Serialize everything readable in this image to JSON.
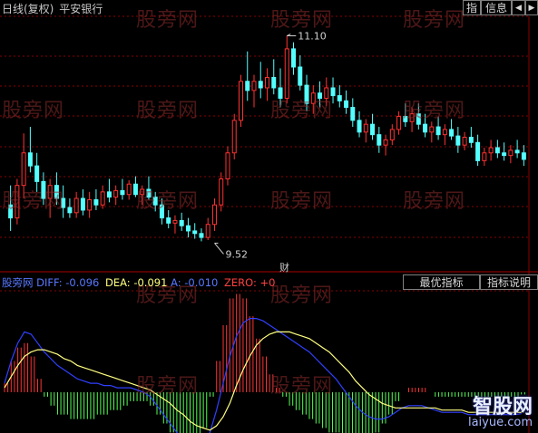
{
  "header": {
    "title": "日线(复权)",
    "stock_name": "平安银行",
    "btn_index": "指",
    "btn_info": "信息",
    "arrow_left": "◀",
    "arrow_right": "▶"
  },
  "indicator_header": {
    "name": "股旁网",
    "diff_label": "DIFF:",
    "diff_value": "-0.096",
    "dea_label": "DEA:",
    "dea_value": "-0.091",
    "a_label": "A:",
    "a_value": "-0.010",
    "zero_label": "ZERO:",
    "zero_value": "+0",
    "btn_best": "最优指标",
    "btn_help": "指标说明"
  },
  "watermark": "股旁网",
  "finance_marker": "财",
  "brand": {
    "cn": "智股网",
    "url": "laiyue.com"
  },
  "colors": {
    "background": "#000000",
    "up": "#ff3232",
    "down": "#54ffff",
    "grid": "#8b0000",
    "diff": "#3040ff",
    "dea": "#ffff80",
    "hist_up": "#ff3232",
    "hist_down": "#54ff54",
    "text_blue": "#5878ff",
    "text_yellow": "#ffff80",
    "text_red": "#ff4040"
  },
  "chart_data": [
    {
      "type": "candlestick",
      "ylim": [
        9.3,
        11.25
      ],
      "annotations": [
        {
          "label": "11.10",
          "index": 42,
          "value": 11.1
        },
        {
          "label": "9.52",
          "index": 31,
          "value": 9.52
        }
      ],
      "ohlc": [
        [
          9.8,
          9.95,
          9.6,
          9.7
        ],
        [
          9.7,
          10.0,
          9.65,
          9.95
        ],
        [
          9.95,
          10.35,
          9.85,
          10.2
        ],
        [
          10.2,
          10.4,
          10.05,
          10.1
        ],
        [
          10.1,
          10.2,
          9.9,
          9.98
        ],
        [
          9.98,
          10.05,
          9.8,
          9.85
        ],
        [
          9.85,
          10.0,
          9.7,
          9.95
        ],
        [
          9.95,
          10.05,
          9.8,
          9.85
        ],
        [
          9.85,
          9.95,
          9.7,
          9.78
        ],
        [
          9.78,
          9.85,
          9.7,
          9.74
        ],
        [
          9.74,
          9.9,
          9.7,
          9.85
        ],
        [
          9.85,
          9.92,
          9.72,
          9.76
        ],
        [
          9.76,
          9.9,
          9.7,
          9.84
        ],
        [
          9.84,
          9.92,
          9.76,
          9.8
        ],
        [
          9.8,
          9.95,
          9.77,
          9.9
        ],
        [
          9.9,
          10.0,
          9.82,
          9.86
        ],
        [
          9.86,
          9.95,
          9.8,
          9.91
        ],
        [
          9.91,
          10.0,
          9.84,
          9.88
        ],
        [
          9.88,
          9.99,
          9.84,
          9.96
        ],
        [
          9.96,
          10.02,
          9.86,
          9.88
        ],
        [
          9.88,
          9.95,
          9.8,
          9.92
        ],
        [
          9.92,
          10.02,
          9.84,
          9.86
        ],
        [
          9.86,
          9.9,
          9.75,
          9.8
        ],
        [
          9.8,
          9.85,
          9.65,
          9.7
        ],
        [
          9.7,
          9.76,
          9.62,
          9.66
        ],
        [
          9.66,
          9.72,
          9.58,
          9.68
        ],
        [
          9.68,
          9.74,
          9.6,
          9.64
        ],
        [
          9.64,
          9.7,
          9.55,
          9.6
        ],
        [
          9.6,
          9.66,
          9.54,
          9.58
        ],
        [
          9.58,
          9.62,
          9.52,
          9.55
        ],
        [
          9.55,
          9.7,
          9.53,
          9.65
        ],
        [
          9.65,
          9.85,
          9.6,
          9.8
        ],
        [
          9.8,
          10.05,
          9.75,
          10.0
        ],
        [
          10.0,
          10.25,
          9.95,
          10.2
        ],
        [
          10.2,
          10.5,
          10.15,
          10.45
        ],
        [
          10.45,
          10.8,
          10.4,
          10.75
        ],
        [
          10.75,
          10.98,
          10.6,
          10.68
        ],
        [
          10.68,
          10.8,
          10.55,
          10.75
        ],
        [
          10.75,
          10.9,
          10.62,
          10.7
        ],
        [
          10.7,
          10.85,
          10.6,
          10.78
        ],
        [
          10.78,
          10.92,
          10.65,
          10.7
        ],
        [
          10.7,
          10.85,
          10.55,
          10.62
        ],
        [
          10.62,
          11.1,
          10.58,
          11.0
        ],
        [
          11.0,
          11.05,
          10.8,
          10.86
        ],
        [
          10.86,
          10.95,
          10.68,
          10.72
        ],
        [
          10.72,
          10.8,
          10.52,
          10.58
        ],
        [
          10.58,
          10.72,
          10.5,
          10.66
        ],
        [
          10.66,
          10.75,
          10.55,
          10.62
        ],
        [
          10.62,
          10.78,
          10.56,
          10.7
        ],
        [
          10.7,
          10.78,
          10.58,
          10.64
        ],
        [
          10.64,
          10.72,
          10.55,
          10.6
        ],
        [
          10.6,
          10.68,
          10.5,
          10.55
        ],
        [
          10.55,
          10.62,
          10.4,
          10.45
        ],
        [
          10.45,
          10.52,
          10.32,
          10.36
        ],
        [
          10.36,
          10.46,
          10.28,
          10.42
        ],
        [
          10.42,
          10.5,
          10.3,
          10.34
        ],
        [
          10.34,
          10.4,
          10.2,
          10.26
        ],
        [
          10.26,
          10.34,
          10.18,
          10.3
        ],
        [
          10.3,
          10.42,
          10.26,
          10.38
        ],
        [
          10.38,
          10.52,
          10.34,
          10.48
        ],
        [
          10.48,
          10.58,
          10.4,
          10.44
        ],
        [
          10.44,
          10.55,
          10.36,
          10.5
        ],
        [
          10.5,
          10.58,
          10.38,
          10.42
        ],
        [
          10.42,
          10.5,
          10.32,
          10.36
        ],
        [
          10.36,
          10.44,
          10.28,
          10.4
        ],
        [
          10.4,
          10.48,
          10.3,
          10.34
        ],
        [
          10.34,
          10.42,
          10.26,
          10.38
        ],
        [
          10.38,
          10.46,
          10.3,
          10.33
        ],
        [
          10.33,
          10.4,
          10.2,
          10.26
        ],
        [
          10.26,
          10.36,
          10.22,
          10.32
        ],
        [
          10.32,
          10.4,
          10.24,
          10.28
        ],
        [
          10.28,
          10.34,
          10.1,
          10.14
        ],
        [
          10.14,
          10.24,
          10.1,
          10.2
        ],
        [
          10.2,
          10.3,
          10.14,
          10.24
        ],
        [
          10.24,
          10.3,
          10.16,
          10.2
        ],
        [
          10.2,
          10.28,
          10.14,
          10.18
        ],
        [
          10.18,
          10.26,
          10.12,
          10.22
        ],
        [
          10.22,
          10.3,
          10.16,
          10.2
        ],
        [
          10.2,
          10.26,
          10.1,
          10.15
        ]
      ]
    },
    {
      "type": "macd",
      "ylim": [
        -0.45,
        0.45
      ],
      "series": [
        {
          "name": "DIFF",
          "values": [
            0.04,
            0.14,
            0.22,
            0.27,
            0.26,
            0.22,
            0.18,
            0.15,
            0.12,
            0.1,
            0.08,
            0.06,
            0.05,
            0.04,
            0.04,
            0.03,
            0.03,
            0.02,
            0.02,
            0.02,
            0.01,
            0.0,
            -0.02,
            -0.06,
            -0.1,
            -0.14,
            -0.18,
            -0.22,
            -0.25,
            -0.26,
            -0.24,
            -0.18,
            -0.08,
            0.04,
            0.16,
            0.25,
            0.31,
            0.33,
            0.33,
            0.32,
            0.3,
            0.28,
            0.26,
            0.24,
            0.22,
            0.2,
            0.18,
            0.15,
            0.12,
            0.09,
            0.06,
            0.02,
            -0.02,
            -0.06,
            -0.09,
            -0.11,
            -0.12,
            -0.12,
            -0.11,
            -0.09,
            -0.07,
            -0.06,
            -0.06,
            -0.06,
            -0.07,
            -0.08,
            -0.09,
            -0.09,
            -0.09,
            -0.09,
            -0.1,
            -0.1,
            -0.1,
            -0.1,
            -0.1,
            -0.1,
            -0.1,
            -0.1,
            -0.096
          ]
        },
        {
          "name": "DEA",
          "values": [
            0.02,
            0.07,
            0.12,
            0.16,
            0.18,
            0.19,
            0.19,
            0.18,
            0.17,
            0.15,
            0.14,
            0.12,
            0.11,
            0.1,
            0.09,
            0.08,
            0.07,
            0.06,
            0.05,
            0.04,
            0.03,
            0.02,
            0.01,
            -0.01,
            -0.03,
            -0.05,
            -0.08,
            -0.1,
            -0.13,
            -0.15,
            -0.16,
            -0.17,
            -0.15,
            -0.11,
            -0.05,
            0.03,
            0.1,
            0.16,
            0.21,
            0.24,
            0.26,
            0.27,
            0.27,
            0.27,
            0.26,
            0.25,
            0.24,
            0.22,
            0.2,
            0.18,
            0.15,
            0.12,
            0.09,
            0.05,
            0.02,
            -0.01,
            -0.03,
            -0.05,
            -0.06,
            -0.07,
            -0.07,
            -0.07,
            -0.07,
            -0.07,
            -0.07,
            -0.07,
            -0.08,
            -0.08,
            -0.08,
            -0.08,
            -0.09,
            -0.09,
            -0.09,
            -0.09,
            -0.09,
            -0.09,
            -0.09,
            -0.09,
            -0.091
          ]
        }
      ]
    }
  ]
}
